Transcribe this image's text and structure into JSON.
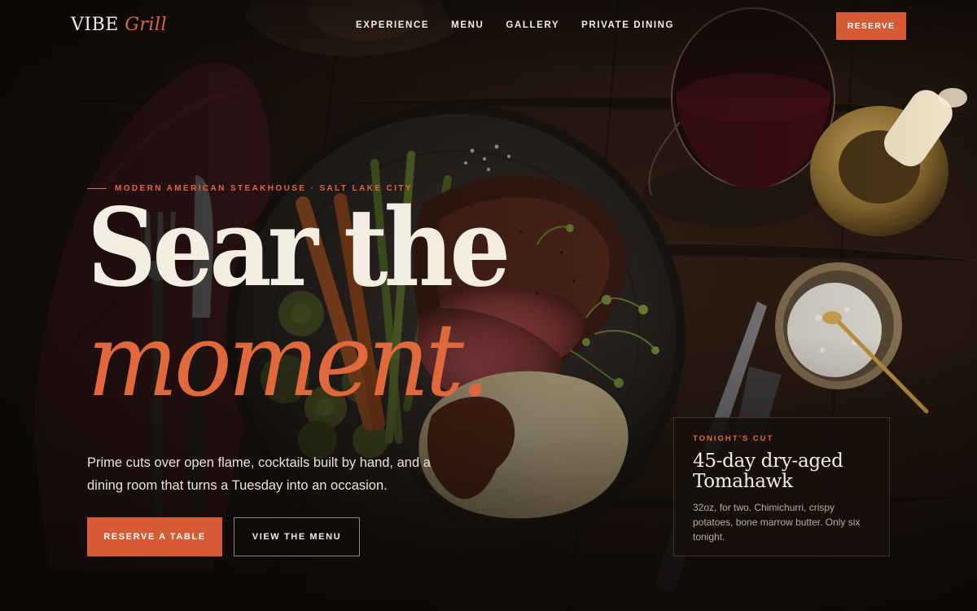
{
  "brand": {
    "name": "VIBE",
    "accent": "Grill"
  },
  "nav": {
    "links": [
      "EXPERIENCE",
      "MENU",
      "GALLERY",
      "PRIVATE DINING"
    ],
    "reserve_label": "RESERVE"
  },
  "hero": {
    "eyebrow": "MODERN AMERICAN STEAKHOUSE · SALT LAKE CITY",
    "headline_line1": "Sear the",
    "headline_line2": "moment.",
    "lede": "Prime cuts over open flame, cocktails built by hand, and a dining room that turns a Tuesday into an occasion.",
    "primary_cta": "RESERVE A TABLE",
    "secondary_cta": "VIEW THE MENU"
  },
  "special": {
    "label": "TONIGHT'S CUT",
    "title": "45-day dry-aged Tomahawk",
    "description": "32oz, for two. Chimichurri, crispy potatoes, bone marrow butter. Only six tonight."
  },
  "colors": {
    "accent": "#d65a33",
    "accent_text": "#e0683d",
    "background": "#160f0b",
    "text": "#f3ece1",
    "muted_text": "#b9ada0"
  }
}
